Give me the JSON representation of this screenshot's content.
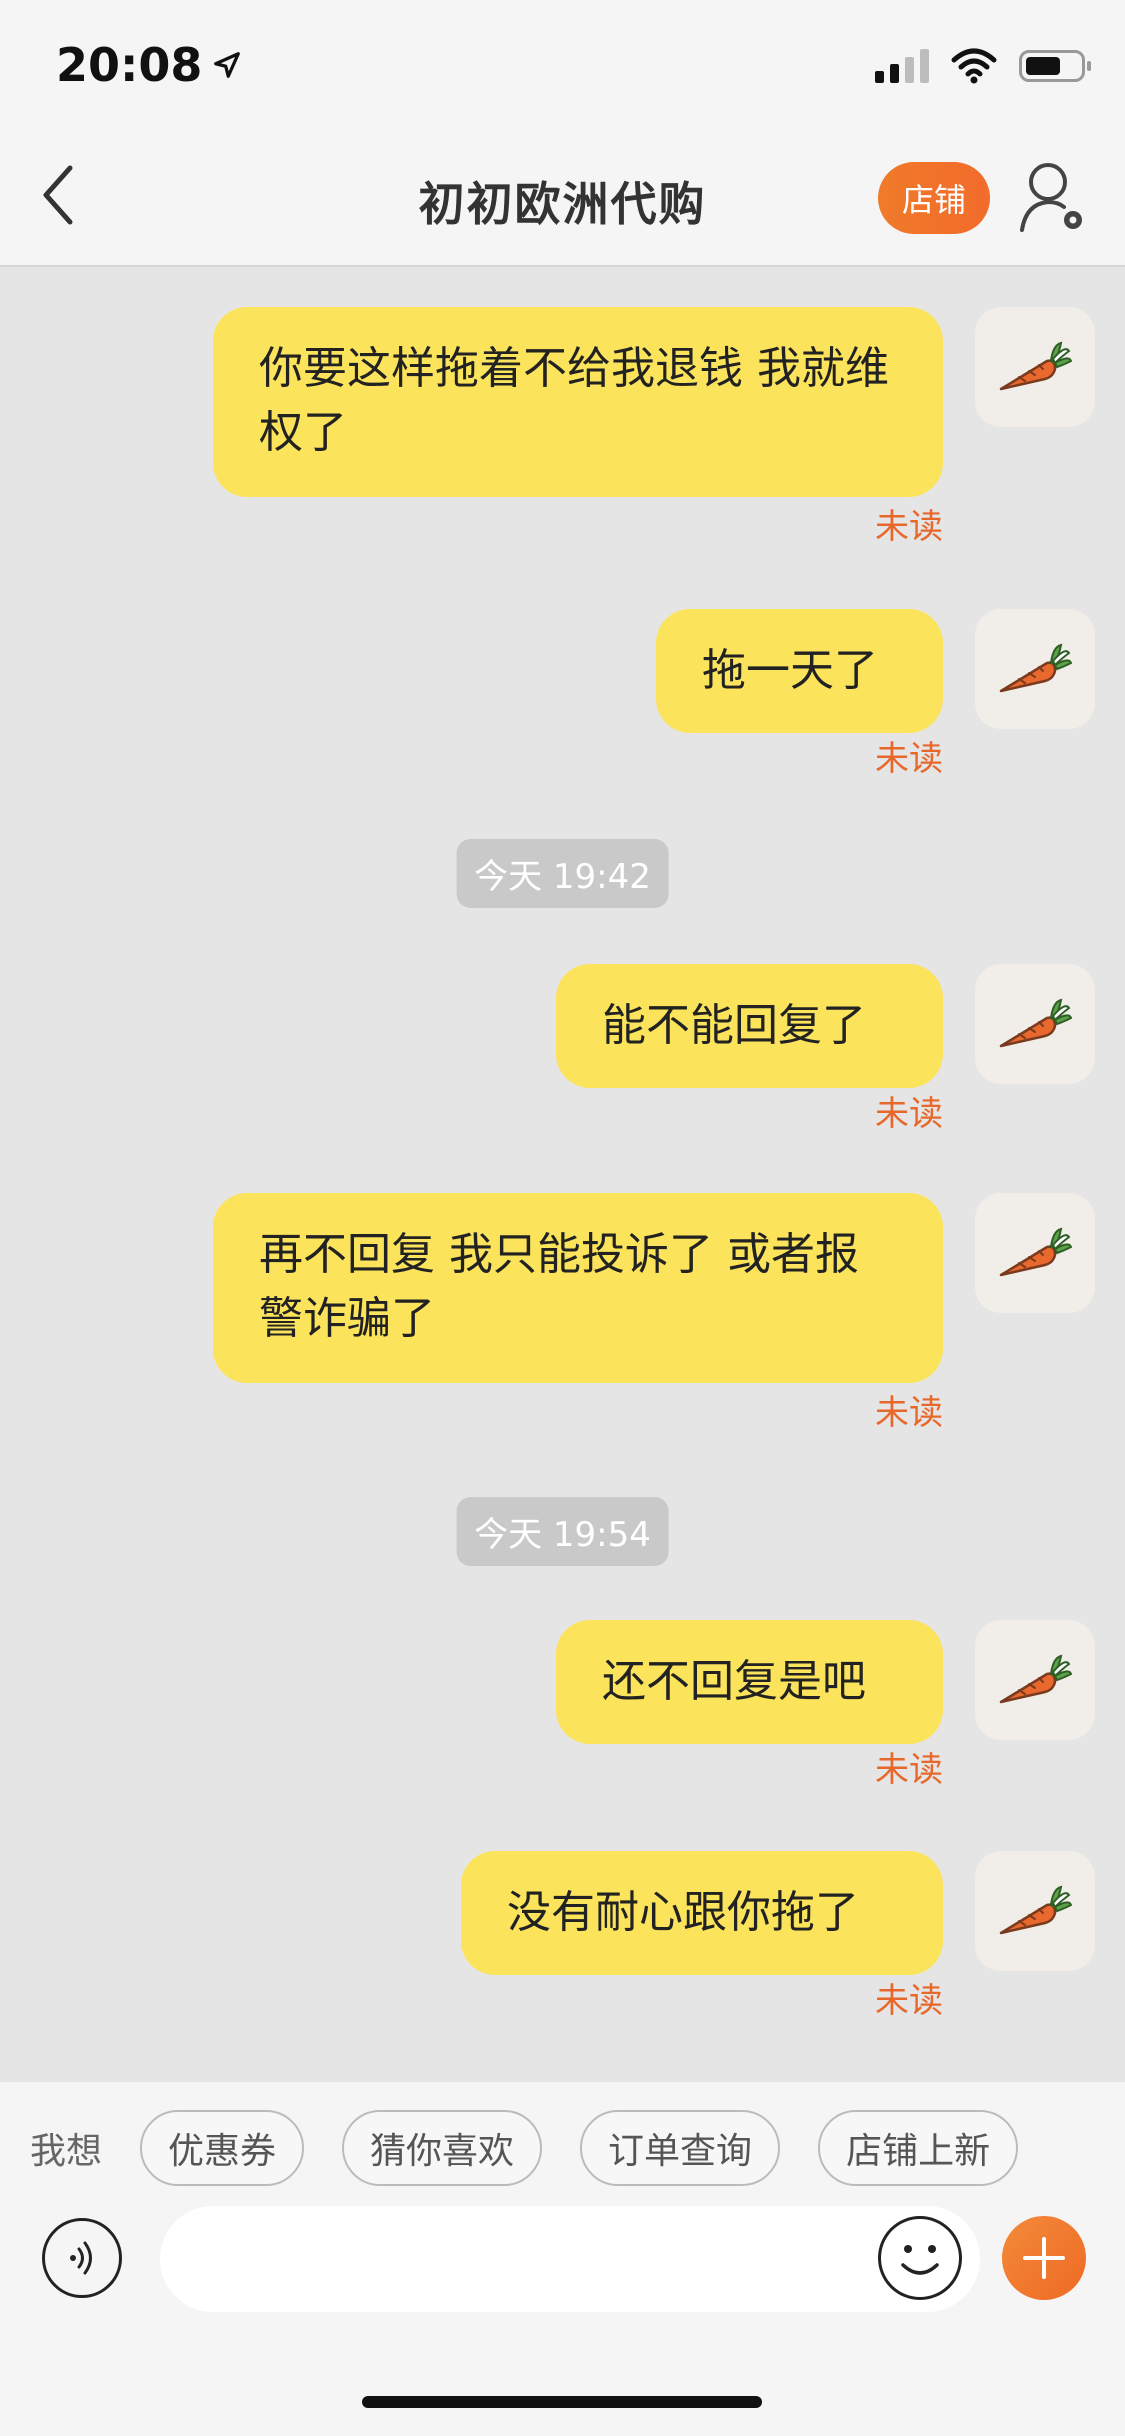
{
  "status_bar": {
    "time": "20:08"
  },
  "header": {
    "title": "初初欧洲代购",
    "shop_label": "店铺"
  },
  "messages": [
    {
      "type": "msg",
      "text": "你要这样拖着不给我退钱 我就维权了",
      "status": "未读"
    },
    {
      "type": "msg",
      "text": "拖一天了",
      "status": "未读"
    },
    {
      "type": "time",
      "text": "今天 19:42"
    },
    {
      "type": "msg",
      "text": "能不能回复了",
      "status": "未读"
    },
    {
      "type": "msg",
      "text": "再不回复 我只能投诉了 或者报警诈骗了",
      "status": "未读"
    },
    {
      "type": "time",
      "text": "今天 19:54"
    },
    {
      "type": "msg",
      "text": "还不回复是吧",
      "status": "未读"
    },
    {
      "type": "msg",
      "text": "没有耐心跟你拖了",
      "status": "未读"
    }
  ],
  "quick_replies": {
    "label": "我想",
    "chips": [
      "优惠券",
      "猜你喜欢",
      "订单查询",
      "店铺上新"
    ]
  },
  "input": {
    "value": "",
    "placeholder": ""
  },
  "colors": {
    "bubble": "#fbe45b",
    "accent": "#f07a2a",
    "unread": "#e8672b"
  },
  "icons": [
    "location-arrow-icon",
    "signal-icon",
    "wifi-icon",
    "battery-icon",
    "back-chevron-icon",
    "user-settings-icon",
    "carrot-avatar-icon",
    "voice-icon",
    "emoji-icon",
    "plus-icon"
  ]
}
